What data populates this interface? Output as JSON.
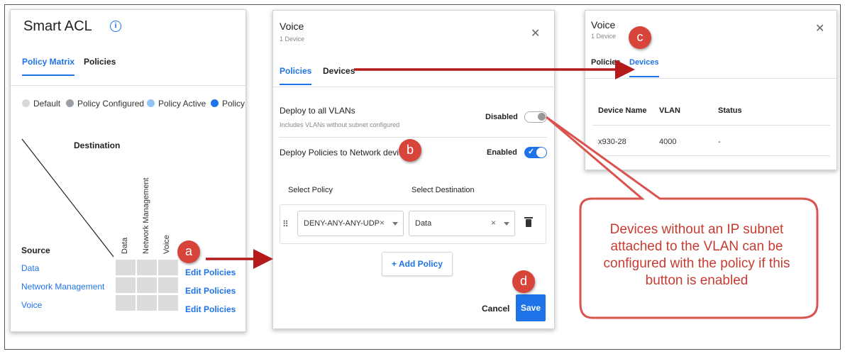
{
  "smart_acl": {
    "title": "Smart ACL",
    "info_icon": "info-icon",
    "tabs": [
      "Policy Matrix",
      "Policies"
    ],
    "legend": [
      {
        "label": "Default",
        "color": "#d9d9d9"
      },
      {
        "label": "Policy Configured",
        "color": "#9aa0a6"
      },
      {
        "label": "Policy Active",
        "color": "#8ec5f5"
      },
      {
        "label": "Policy",
        "color": "#1f73e8"
      }
    ],
    "destination_label": "Destination",
    "destination_columns": [
      "Data",
      "Network Management",
      "Voice"
    ],
    "source_label": "Source",
    "sources": [
      "Data",
      "Network Management",
      "Voice"
    ],
    "edit_policies": [
      "Edit Policies",
      "Edit Policies",
      "Edit Policies"
    ]
  },
  "voice_panel": {
    "title": "Voice",
    "subtitle": "1 Device",
    "tabs": [
      "Policies",
      "Devices"
    ],
    "deploy_all": {
      "label": "Deploy to all VLANs",
      "sub": "Includes VLANs without subnet configured",
      "state": "Disabled"
    },
    "deploy_network": {
      "label": "Deploy Policies to Network devices",
      "state": "Enabled"
    },
    "select_policy_label": "Select Policy",
    "select_destination_label": "Select Destination",
    "policy_value": "DENY-ANY-ANY-UDP",
    "destination_value": "Data",
    "add_policy": "+ Add Policy",
    "cancel": "Cancel",
    "save": "Save"
  },
  "devices_panel": {
    "title": "Voice",
    "subtitle": "1 Device",
    "tabs": [
      "Policies",
      "Devices"
    ],
    "columns": [
      "Device Name",
      "VLAN",
      "Status"
    ],
    "rows": [
      [
        "x930-28",
        "4000",
        "-"
      ]
    ]
  },
  "annotations": {
    "badges": [
      "a",
      "b",
      "c",
      "d"
    ],
    "callout": "Devices without an IP subnet attached to the VLAN can be configured with the policy if this button is enabled"
  },
  "colors": {
    "accent": "#1f73e8",
    "annotation": "#d7443a"
  }
}
